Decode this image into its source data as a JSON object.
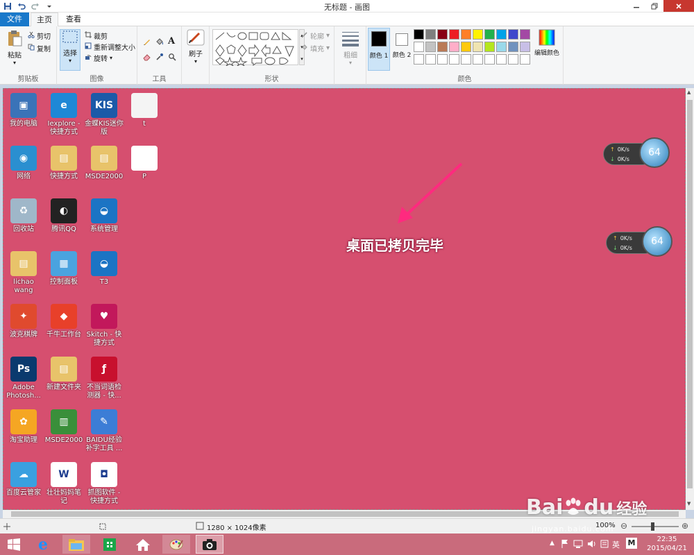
{
  "window": {
    "title": "无标题 - 画图",
    "controls": [
      "min",
      "max",
      "close"
    ]
  },
  "qat": {
    "icons": [
      "save-icon",
      "undo-icon",
      "redo-icon",
      "customize-icon"
    ]
  },
  "tabs": {
    "file": "文件",
    "home": "主页",
    "view": "查看"
  },
  "ribbon": {
    "clipboard": {
      "paste": "粘贴",
      "cut": "剪切",
      "copy": "复制",
      "label": "剪贴板"
    },
    "image": {
      "select": "选择",
      "crop": "裁剪",
      "resize": "重新调整大小",
      "rotate": "旋转",
      "label": "图像"
    },
    "tools": {
      "label": "工具"
    },
    "brushes": {
      "label": "刷子"
    },
    "shapes": {
      "outline": "轮廓",
      "fill": "填充",
      "label": "形状"
    },
    "size": {
      "label": "粗细"
    },
    "colors": {
      "color1": "颜色 1",
      "color2": "颜色 2",
      "edit": "编辑颜色",
      "label": "颜色",
      "palette_row1": [
        "#000000",
        "#7f7f7f",
        "#880015",
        "#ed1c24",
        "#ff7f27",
        "#fff200",
        "#22b14c",
        "#00a2e8",
        "#3f48cc",
        "#a349a4"
      ],
      "palette_row2": [
        "#ffffff",
        "#c3c3c3",
        "#b97a57",
        "#ffaec9",
        "#ffc90e",
        "#efe4b0",
        "#b5e61d",
        "#99d9ea",
        "#7092be",
        "#c8bfe7"
      ],
      "palette_row3": [
        "#ffffff",
        "#ffffff",
        "#ffffff",
        "#ffffff",
        "#ffffff",
        "#ffffff",
        "#ffffff",
        "#ffffff",
        "#ffffff",
        "#ffffff"
      ]
    }
  },
  "canvas": {
    "background": "#d64f6f",
    "annotation": "桌面已拷贝完毕",
    "icons": [
      {
        "label": "我的电脑",
        "color": "#3a73b8",
        "glyph": "▣"
      },
      {
        "label": "Iexplore - 快捷方式",
        "color": "#1e88d6",
        "glyph": "e"
      },
      {
        "label": "金蝶KIS迷你版",
        "color": "#1c5aa8",
        "glyph": "KIS"
      },
      {
        "label": "t",
        "color": "#f4f4f4",
        "glyph": ""
      },
      {
        "label": "网络",
        "color": "#2a8fd0",
        "glyph": "◉"
      },
      {
        "label": "快捷方式",
        "color": "#e8c36a",
        "glyph": "▤"
      },
      {
        "label": "MSDE2000",
        "color": "#e8c36a",
        "glyph": "▤"
      },
      {
        "label": "P",
        "color": "#ffffff",
        "glyph": ""
      },
      {
        "label": "回收站",
        "color": "#9fb7c9",
        "glyph": "♻"
      },
      {
        "label": "腾讯QQ",
        "color": "#222222",
        "glyph": "◐"
      },
      {
        "label": "系统管理",
        "color": "#1b74c4",
        "glyph": "◒"
      },
      {
        "label": "lichao wang",
        "color": "#e8c36a",
        "glyph": "▤"
      },
      {
        "label": "控制面板",
        "color": "#4aa3df",
        "glyph": "▦"
      },
      {
        "label": "T3",
        "color": "#1b74c4",
        "glyph": "◒"
      },
      {
        "label": "波克棋牌",
        "color": "#e04a2e",
        "glyph": "✦"
      },
      {
        "label": "千牛工作台",
        "color": "#e8402a",
        "glyph": "◆"
      },
      {
        "label": "Skitch - 快捷方式",
        "color": "#c2185b",
        "glyph": "♥"
      },
      {
        "label": "Adobe Photosh...",
        "color": "#0a3a6e",
        "glyph": "Ps"
      },
      {
        "label": "新建文件夹",
        "color": "#e8c36a",
        "glyph": "▤"
      },
      {
        "label": "不当词语检测器 - 快...",
        "color": "#c8102e",
        "glyph": "ƒ"
      },
      {
        "label": "淘宝助理",
        "color": "#f5a623",
        "glyph": "✿"
      },
      {
        "label": "MSDE2000",
        "color": "#3a8f3a",
        "glyph": "▥"
      },
      {
        "label": "BAIDU经验补字工具 ...",
        "color": "#3c7dd6",
        "glyph": "✎"
      },
      {
        "label": "百度云管家",
        "color": "#3aa0e0",
        "glyph": "☁"
      },
      {
        "label": "壮壮妈妈笔记",
        "color": "#ffffff",
        "glyph": "W"
      },
      {
        "label": "抓图软件 - 快捷方式",
        "color": "#ffffff",
        "glyph": "◘"
      }
    ],
    "gadgets": [
      {
        "up": "0K/s",
        "down": "0K/s",
        "cpu": "64"
      },
      {
        "up": "0K/s",
        "down": "0K/s",
        "cpu": "64"
      }
    ]
  },
  "status": {
    "dimensions": "1280 × 1024像素",
    "zoom": "100%"
  },
  "taskbar": {
    "ime": "英",
    "ime2": "M",
    "time": "22:35",
    "date": "2015/04/21"
  },
  "watermark": {
    "brand": "Bai",
    "brand2": "du",
    "brand_cn": "经验",
    "url": "jingyan.baidu.com"
  }
}
